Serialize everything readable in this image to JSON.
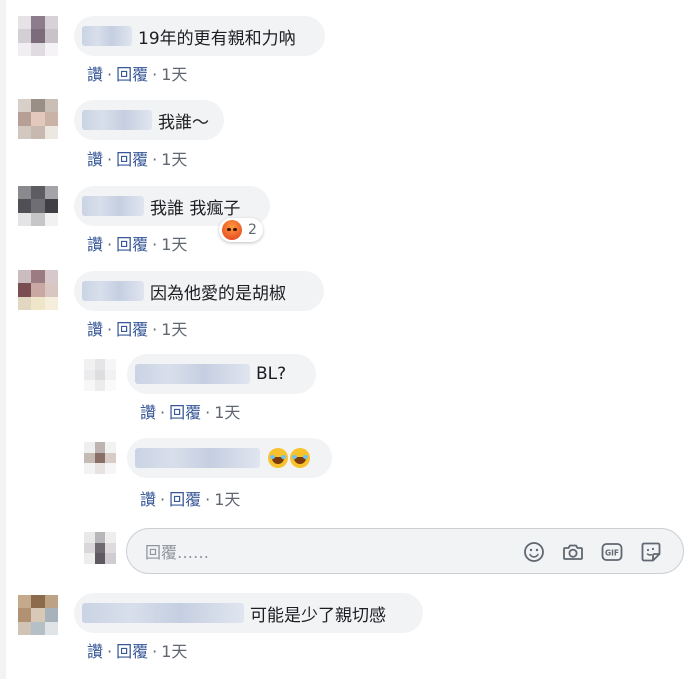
{
  "comments": [
    {
      "text": "19年的更有親和力吶",
      "like": "讚",
      "reply": "回覆",
      "time": "1天"
    },
    {
      "text": "我誰～",
      "like": "讚",
      "reply": "回覆",
      "time": "1天"
    },
    {
      "text": "我誰 我瘋子",
      "like": "讚",
      "reply": "回覆",
      "time": "1天",
      "reaction_count": "2"
    },
    {
      "text": "因為他愛的是胡椒",
      "like": "讚",
      "reply": "回覆",
      "time": "1天"
    },
    {
      "text": "BL?",
      "like": "讚",
      "reply": "回覆",
      "time": "1天"
    },
    {
      "text": "",
      "like": "讚",
      "reply": "回覆",
      "time": "1天"
    },
    {
      "text": "可能是少了親切感",
      "like": "讚",
      "reply": "回覆",
      "time": "1天"
    }
  ],
  "reply_input": {
    "placeholder": "回覆……"
  },
  "icons": {
    "emoji": "smiley-icon",
    "camera": "camera-icon",
    "gif": "gif-icon",
    "sticker": "sticker-icon",
    "reaction": "angry-reaction-icon",
    "laugh": "laughing-emoji-icon"
  },
  "colors": {
    "bubble": "#f2f3f5",
    "link": "#385898",
    "muted": "#606770"
  }
}
